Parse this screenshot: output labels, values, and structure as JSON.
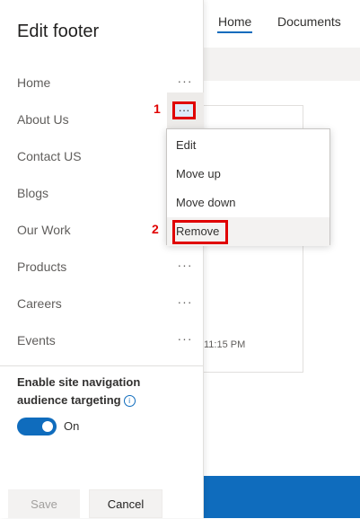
{
  "background": {
    "tabs": [
      "Home",
      "Documents"
    ],
    "timestamp": "11:15 PM"
  },
  "panel": {
    "title": "Edit footer",
    "more_glyph": "···",
    "items": [
      {
        "label": "Home"
      },
      {
        "label": "About Us"
      },
      {
        "label": "Contact US"
      },
      {
        "label": "Blogs"
      },
      {
        "label": "Our Work"
      },
      {
        "label": "Products"
      },
      {
        "label": "Careers"
      },
      {
        "label": "Events"
      }
    ],
    "targeting_label": "Enable site navigation audience targeting",
    "info_glyph": "i",
    "toggle_state": "On",
    "save_label": "Save",
    "cancel_label": "Cancel"
  },
  "steps": [
    "1",
    "2"
  ],
  "context_menu": {
    "items": [
      "Edit",
      "Move up",
      "Move down",
      "Remove"
    ],
    "highlighted": "Remove"
  },
  "colors": {
    "accent": "#0f6cbd",
    "annotation": "#e00000"
  }
}
